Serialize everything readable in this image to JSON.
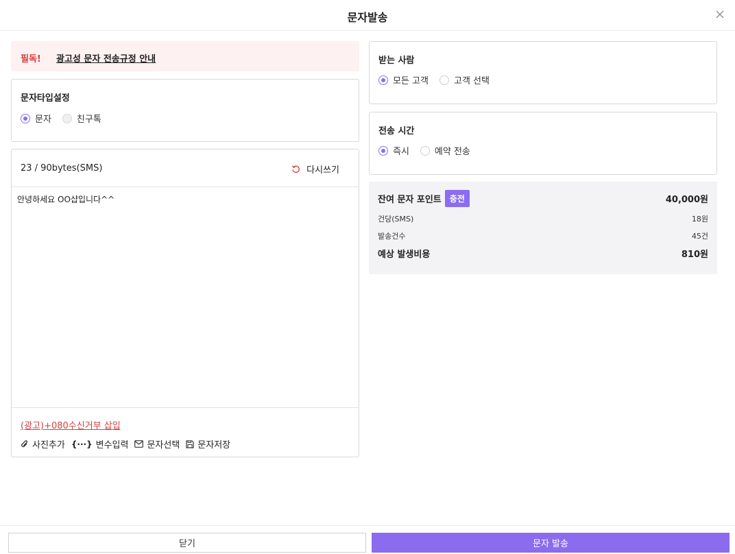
{
  "header": {
    "title": "문자발송"
  },
  "notice": {
    "must": "필독!",
    "link": "광고성 문자 전송규정 안내"
  },
  "type_panel": {
    "title": "문자타입설정",
    "options": [
      {
        "label": "문자",
        "selected": true
      },
      {
        "label": "친구톡",
        "selected": false
      }
    ]
  },
  "editor": {
    "bytes": "23 / 90bytes(SMS)",
    "rewrite_label": "다시쓰기",
    "message": "안녕하세요 OO샵입니다^^",
    "optout_label": "(광고)+080수신거부 삽입",
    "tools": [
      {
        "label": "사진추가",
        "icon": "paperclip-icon"
      },
      {
        "label": "변수입력",
        "icon": "variable-braces-icon"
      },
      {
        "label": "문자선택",
        "icon": "envelope-icon"
      },
      {
        "label": "문자저장",
        "icon": "floppy-disk-icon"
      }
    ]
  },
  "recipient_panel": {
    "title": "받는 사람",
    "options": [
      {
        "label": "모든 고객",
        "selected": true
      },
      {
        "label": "고객 선택",
        "selected": false
      }
    ]
  },
  "time_panel": {
    "title": "전송 시간",
    "options": [
      {
        "label": "즉시",
        "selected": true
      },
      {
        "label": "예약 전송",
        "selected": false
      }
    ]
  },
  "summary": {
    "points_label": "잔여 문자 포인트",
    "charge_label": "충전",
    "points_value": "40,000원",
    "unit_label": "건당(SMS)",
    "unit_value": "18원",
    "count_label": "발송건수",
    "count_value": "45건",
    "cost_label": "예상 발생비용",
    "cost_value": "810원"
  },
  "footer": {
    "close_label": "닫기",
    "send_label": "문자 발송"
  },
  "colors": {
    "accent": "#8b6cef",
    "danger": "#d63f3f",
    "notice_bg": "#fdf1f1",
    "summary_bg": "#f3f3f5"
  }
}
